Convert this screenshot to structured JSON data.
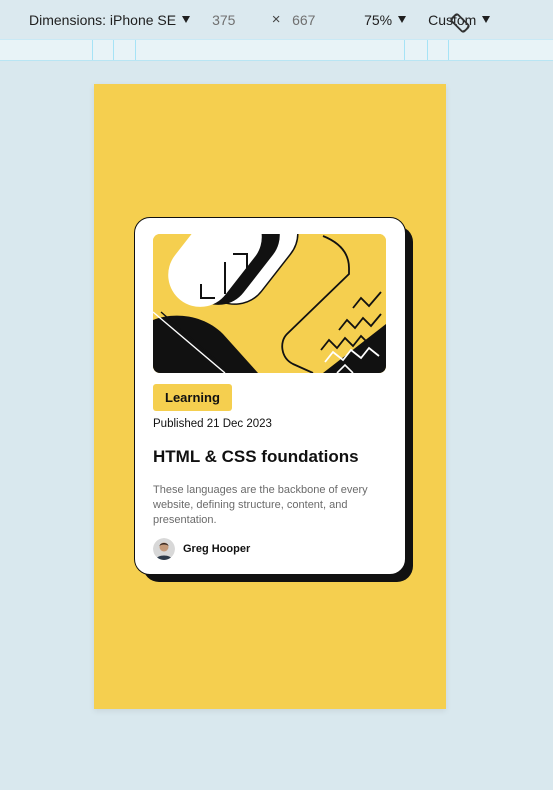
{
  "toolbar": {
    "dimensions_label": "Dimensions: iPhone SE",
    "width_value": "375",
    "height_value": "667",
    "times_sign": "×",
    "zoom_label": "75%",
    "throttle_label": "Custom",
    "rotate_icon": "rotate-device-icon"
  },
  "card": {
    "tag": "Learning",
    "published": "Published 21 Dec 2023",
    "title": "HTML & CSS foundations",
    "description": "These languages are the backbone of every website, defining structure, content, and presentation.",
    "author": "Greg Hooper"
  },
  "colors": {
    "accent_yellow": "#f5cf4f",
    "ink": "#111111",
    "body_text": "#6b6b6b",
    "devtools_bg": "#d9e8ee",
    "ruler_line": "#a6e3f6"
  }
}
